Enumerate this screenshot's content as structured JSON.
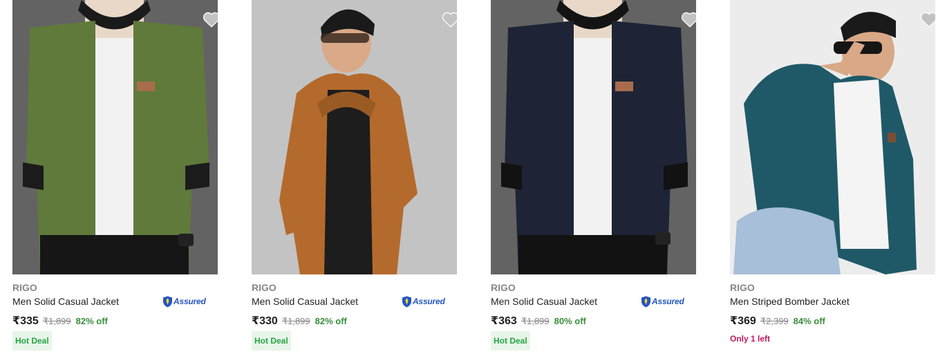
{
  "colors": {
    "brand_text": "#878787",
    "price": "#212121",
    "discount": "#388e3c",
    "hot_deal_bg": "#e8f5e9",
    "hot_deal_text": "#26a541",
    "low_stock": "#c2185b",
    "assured": "#2455c3",
    "wishlist_icon": "#c2c2c2"
  },
  "products": [
    {
      "brand": "RIGO",
      "title": "Men Solid Casual Jacket",
      "assured": "Assured",
      "price": "₹335",
      "mrp": "₹1,899",
      "discount": "82% off",
      "tag": "Hot Deal",
      "image_icon": "olive-green-jacket-photo",
      "wishlist_icon": "heart-icon"
    },
    {
      "brand": "RIGO",
      "title": "Men Solid Casual Jacket",
      "assured": "Assured",
      "price": "₹330",
      "mrp": "₹1,899",
      "discount": "82% off",
      "tag": "Hot Deal",
      "image_icon": "brown-hooded-jacket-photo",
      "wishlist_icon": "heart-icon"
    },
    {
      "brand": "RIGO",
      "title": "Men Solid Casual Jacket",
      "assured": "Assured",
      "price": "₹363",
      "mrp": "₹1,899",
      "discount": "80% off",
      "tag": "Hot Deal",
      "image_icon": "navy-jacket-photo",
      "wishlist_icon": "heart-icon"
    },
    {
      "brand": "RIGO",
      "title": "Men Striped Bomber Jacket",
      "price": "₹369",
      "mrp": "₹2,399",
      "discount": "84% off",
      "stock_note": "Only 1 left",
      "image_icon": "teal-bomber-jacket-photo",
      "wishlist_icon": "heart-icon"
    }
  ]
}
